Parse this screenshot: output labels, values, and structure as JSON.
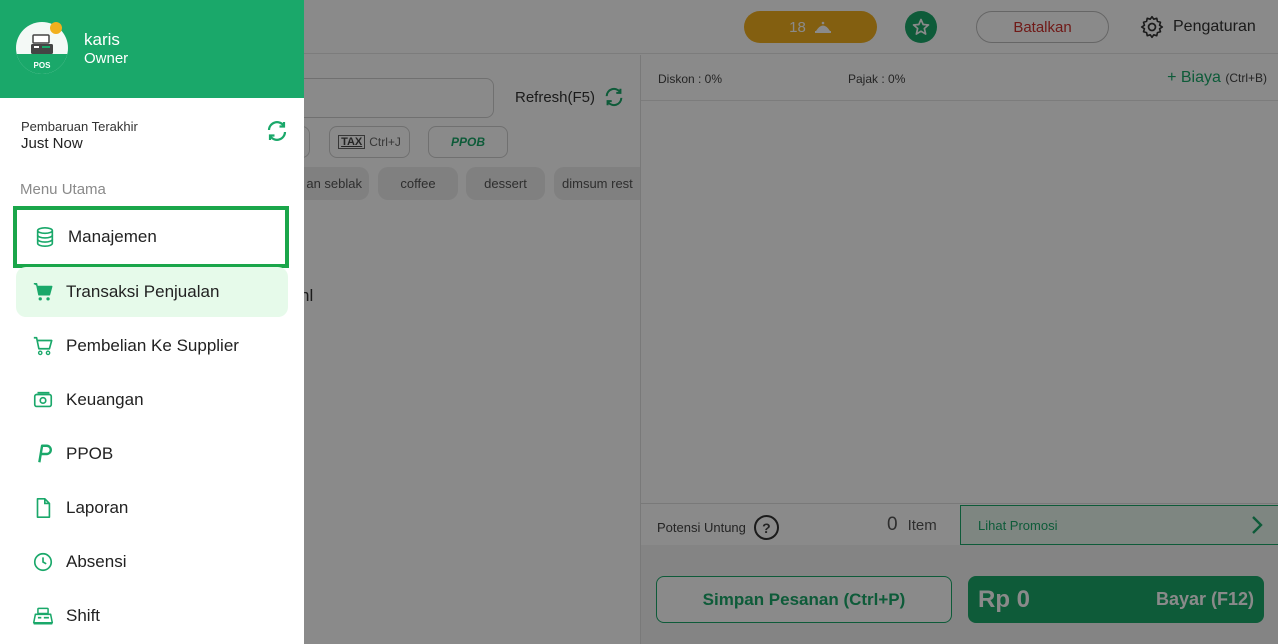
{
  "topbar": {
    "order_count": "18",
    "cancel_label": "Batalkan",
    "settings_label": "Pengaturan"
  },
  "left_panel": {
    "refresh_label": "Refresh(F5)",
    "tax_chip": {
      "icon_text": "TAX",
      "shortcut": "Ctrl+J"
    },
    "ppob_chip": "PPOB",
    "categories": [
      "an seblak",
      "coffee",
      "dessert",
      "dimsum rest"
    ],
    "empty_fragment": "nl"
  },
  "right_panel": {
    "discount": "Diskon : 0%",
    "tax": "Pajak : 0%",
    "add_cost": "+ Biaya",
    "add_cost_shortcut": "(Ctrl+B)",
    "potential_profit": "Potensi Untung",
    "potential_help": "?",
    "item_count": "0",
    "item_label": "Item",
    "promo_label": "Lihat Promosi",
    "save_order": "Simpan Pesanan (Ctrl+P)",
    "pay_amount": "Rp 0",
    "pay_label": "Bayar (F12)"
  },
  "drawer": {
    "user_name": "karis",
    "user_role": "Owner",
    "avatar_text": "POS",
    "last_update_label": "Pembaruan Terakhir",
    "last_update_value": "Just Now",
    "menu_heading": "Menu Utama",
    "menu": [
      {
        "label": "Manajemen",
        "icon": "database-icon"
      },
      {
        "label": "Transaksi Penjualan",
        "icon": "cart-filled-icon"
      },
      {
        "label": "Pembelian Ke Supplier",
        "icon": "cart-outline-icon"
      },
      {
        "label": "Keuangan",
        "icon": "money-icon"
      },
      {
        "label": "PPOB",
        "icon": "ppob-icon"
      },
      {
        "label": "Laporan",
        "icon": "document-icon"
      },
      {
        "label": "Absensi",
        "icon": "clock-icon"
      },
      {
        "label": "Shift",
        "icon": "cash-register-icon"
      }
    ]
  },
  "colors": {
    "brand_green": "#1aa86a",
    "accent_orange": "#f2b01e",
    "danger_red": "#d0312d",
    "focus_outline": "#1aa64a"
  }
}
